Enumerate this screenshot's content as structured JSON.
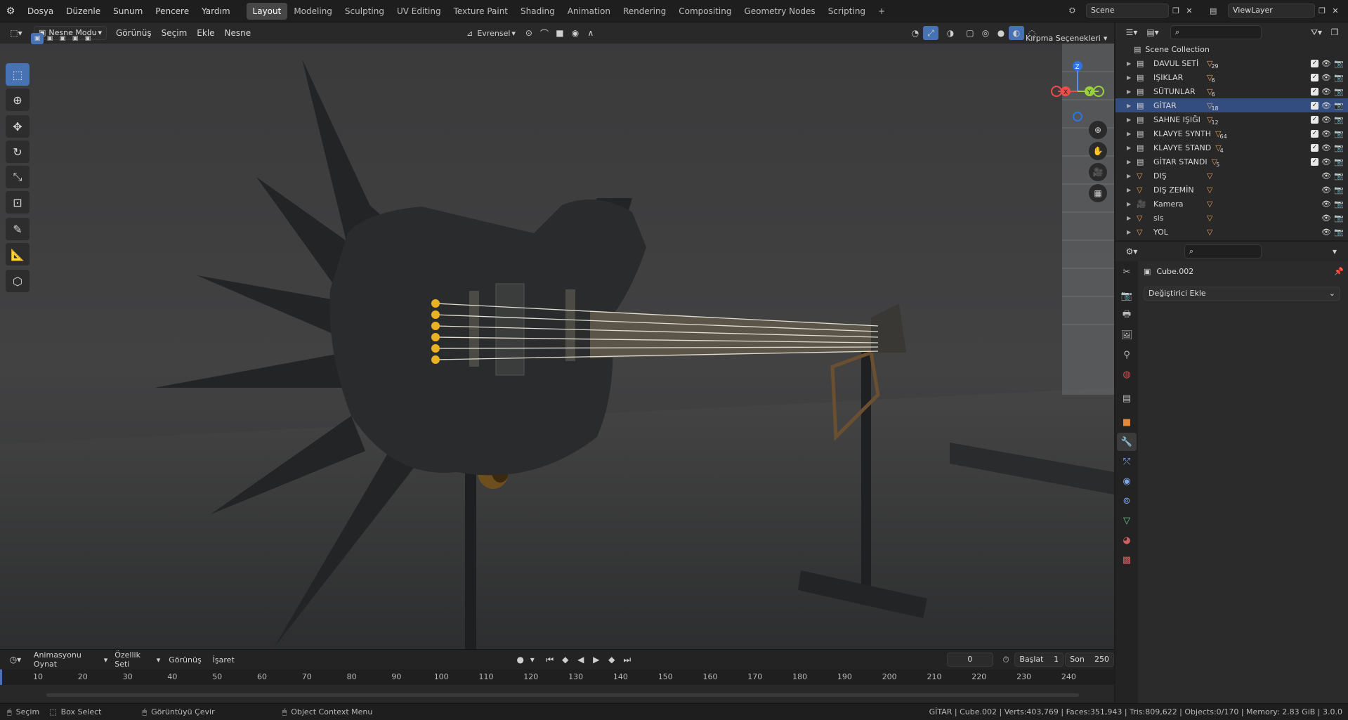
{
  "topbar": {
    "menus": [
      "Dosya",
      "Düzenle",
      "Sunum",
      "Pencere",
      "Yardım"
    ],
    "workspaces": [
      "Layout",
      "Modeling",
      "Sculpting",
      "UV Editing",
      "Texture Paint",
      "Shading",
      "Animation",
      "Rendering",
      "Compositing",
      "Geometry Nodes",
      "Scripting"
    ],
    "active_workspace": "Layout",
    "add_tab": "+",
    "scene": "Scene",
    "view_layer": "ViewLayer"
  },
  "viewport": {
    "mode": "Nesne Modu",
    "menus": [
      "Görünüş",
      "Seçim",
      "Ekle",
      "Nesne"
    ],
    "transform_orientation": "Evrensel",
    "clipping": "Kırpma Seçenekleri",
    "tools": [
      "select-box",
      "cursor",
      "move",
      "rotate",
      "scale",
      "transform",
      "annotate",
      "measure",
      "add-cube"
    ]
  },
  "timeline": {
    "menus": [
      "Animasyonu Oynat",
      "Özellik Seti",
      "Görünüş",
      "İşaret"
    ],
    "current_frame": "0",
    "start_label": "Başlat",
    "start": "1",
    "end_label": "Son",
    "end": "250",
    "ticks": [
      "10",
      "20",
      "30",
      "40",
      "50",
      "60",
      "70",
      "80",
      "90",
      "100",
      "110",
      "120",
      "130",
      "140",
      "150",
      "160",
      "170",
      "180",
      "190",
      "200",
      "210",
      "220",
      "230",
      "240"
    ]
  },
  "statusbar": {
    "select": "Seçim",
    "box_select": "Box Select",
    "rotate_view": "Görüntüyü Çevir",
    "context_menu": "Object Context Menu",
    "stats": "GİTAR | Cube.002 | Verts:403,769 | Faces:351,943 | Tris:809,622 | Objects:0/170 | Memory: 2.83 GiB | 3.0.0"
  },
  "outliner": {
    "root": "Scene Collection",
    "items": [
      {
        "name": "DAVUL SETİ",
        "count": "29",
        "kind": "collection",
        "selected": false,
        "checkbox": true
      },
      {
        "name": "IŞIKLAR",
        "count": "6",
        "kind": "collection",
        "selected": false,
        "checkbox": true
      },
      {
        "name": "SÜTUNLAR",
        "count": "6",
        "kind": "collection",
        "selected": false,
        "checkbox": true
      },
      {
        "name": "GİTAR",
        "count": "18",
        "kind": "collection",
        "selected": true,
        "checkbox": true
      },
      {
        "name": "SAHNE IŞIĞI",
        "count": "12",
        "kind": "collection",
        "selected": false,
        "checkbox": true
      },
      {
        "name": "KLAVYE SYNTH",
        "count": "64",
        "kind": "collection",
        "selected": false,
        "checkbox": true
      },
      {
        "name": "KLAVYE STAND",
        "count": "4",
        "kind": "collection",
        "selected": false,
        "checkbox": true
      },
      {
        "name": "GİTAR STANDI",
        "count": "5",
        "kind": "collection",
        "selected": false,
        "checkbox": true
      },
      {
        "name": "DIŞ",
        "count": "",
        "kind": "mesh",
        "selected": false,
        "checkbox": false
      },
      {
        "name": "DIŞ ZEMİN",
        "count": "",
        "kind": "mesh",
        "selected": false,
        "checkbox": false
      },
      {
        "name": "Kamera",
        "count": "",
        "kind": "camera",
        "selected": false,
        "checkbox": false
      },
      {
        "name": "sis",
        "count": "",
        "kind": "mesh",
        "selected": false,
        "checkbox": false
      },
      {
        "name": "YOL",
        "count": "",
        "kind": "mesh",
        "selected": false,
        "checkbox": false
      }
    ]
  },
  "properties": {
    "object_name": "Cube.002",
    "add_modifier": "Değiştirici Ekle"
  },
  "colors": {
    "accent": "#4772b3",
    "selection_row": "#334d80",
    "collection_icon": "#e7a05a",
    "mesh_icon": "#6fcf97"
  }
}
